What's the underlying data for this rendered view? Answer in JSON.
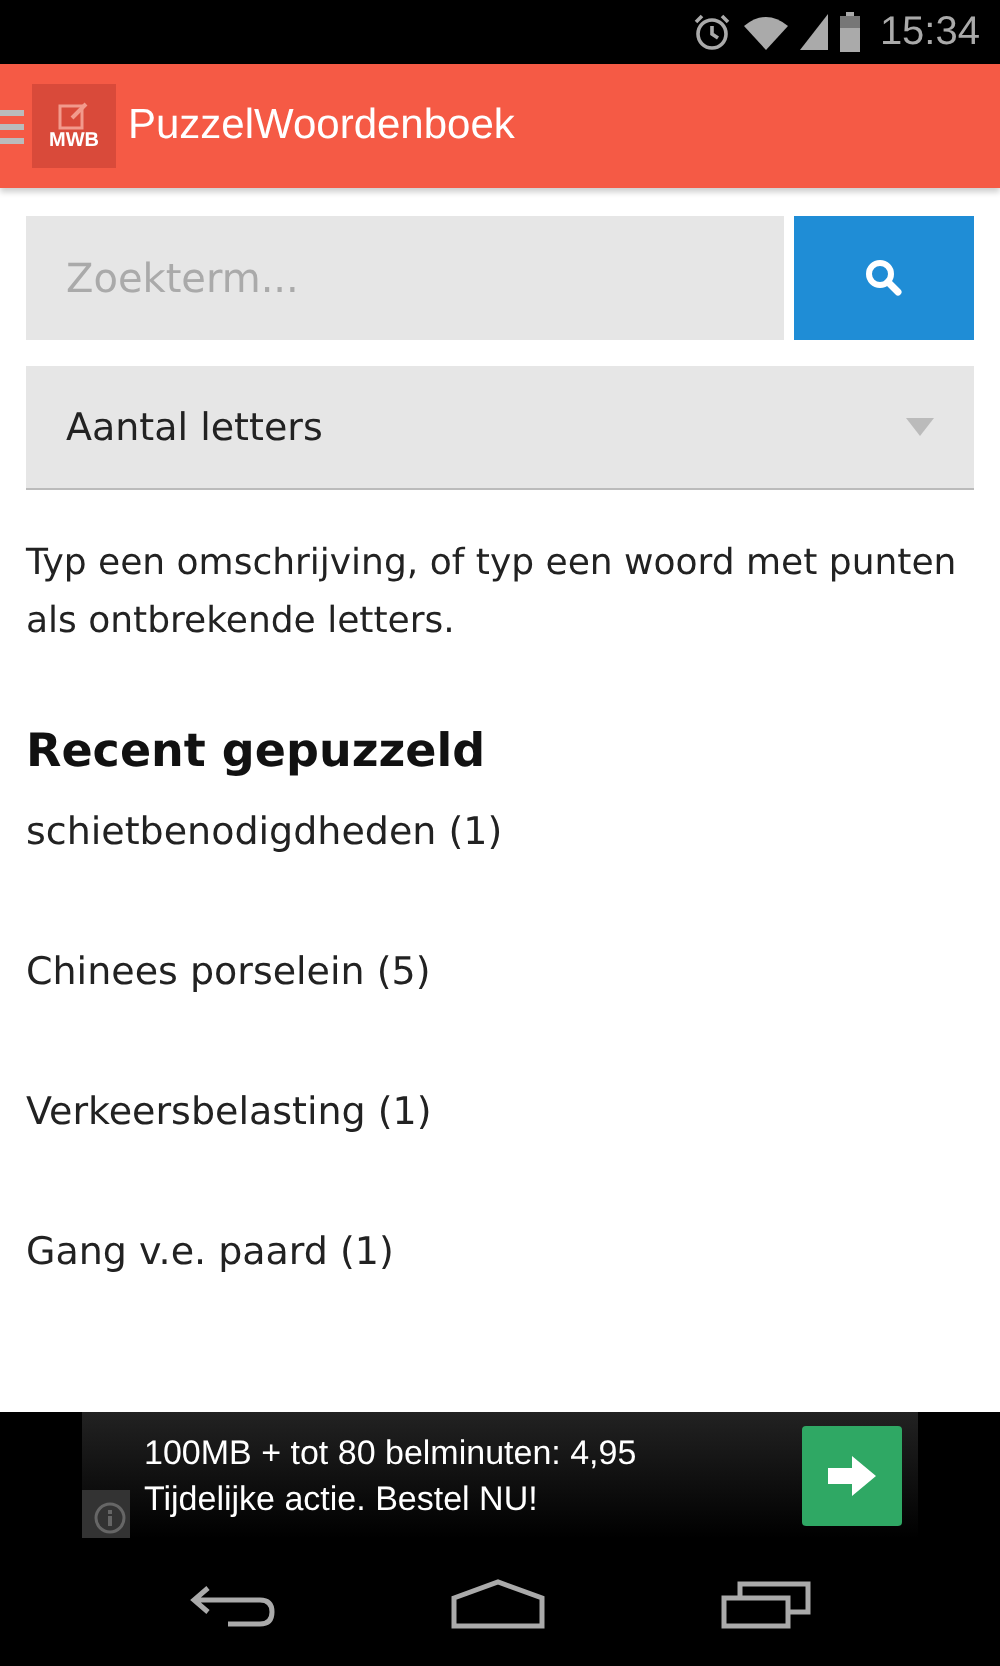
{
  "status_bar": {
    "time": "15:34"
  },
  "app_bar": {
    "logo_text": "MWB",
    "title": "PuzzelWoordenboek"
  },
  "search": {
    "placeholder": "Zoekterm..."
  },
  "letters_dropdown": {
    "label": "Aantal letters"
  },
  "hint": "Typ een omschrijving, of typ een woord met punten als ontbrekende letters.",
  "recent": {
    "heading": "Recent gepuzzeld",
    "items": [
      "schietbenodigdheden (1)",
      "Chinees porselein (5)",
      "Verkeersbelasting (1)",
      "Gang v.e. paard (1)"
    ]
  },
  "ad": {
    "lines": [
      "100MB + tot 80 belminuten: 4,95",
      "Tijdelijke actie. Bestel NU!"
    ]
  }
}
